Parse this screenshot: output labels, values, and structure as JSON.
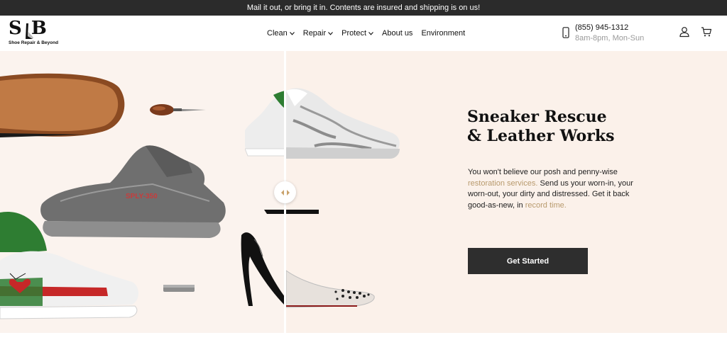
{
  "announcement": "Mail it out, or bring it in. Contents are insured and shipping is on us!",
  "logo": {
    "mark": "S B",
    "subtitle": "Shoe Repair & Beyond"
  },
  "nav": {
    "items": [
      {
        "label": "Clean",
        "has_dropdown": true
      },
      {
        "label": "Repair",
        "has_dropdown": true
      },
      {
        "label": "Protect",
        "has_dropdown": true
      },
      {
        "label": "About us",
        "has_dropdown": false
      },
      {
        "label": "Environment",
        "has_dropdown": false
      }
    ]
  },
  "contact": {
    "phone": "(855) 945-1312",
    "hours": "8am-8pm, Mon-Sun"
  },
  "icons": {
    "phone": "phone-icon",
    "account": "user-icon",
    "cart": "cart-icon",
    "slider": "slider-arrows-icon"
  },
  "hero": {
    "headline_line1": "Sneaker Rescue",
    "headline_line2": "& Leather Works",
    "body_part1": "You won't believe our posh and penny-wise ",
    "link1": "restoration services.",
    "body_part2": " Send us your worn-in, your worn-out, your dirty and distressed. Get it back good-as-new, in ",
    "link2": "record time.",
    "cta": "Get Started"
  },
  "colors": {
    "announce_bg": "#2b2b2b",
    "hero_bg": "#fbf1ea",
    "link": "#b89a6d",
    "cta_bg": "#2e2e2e"
  }
}
